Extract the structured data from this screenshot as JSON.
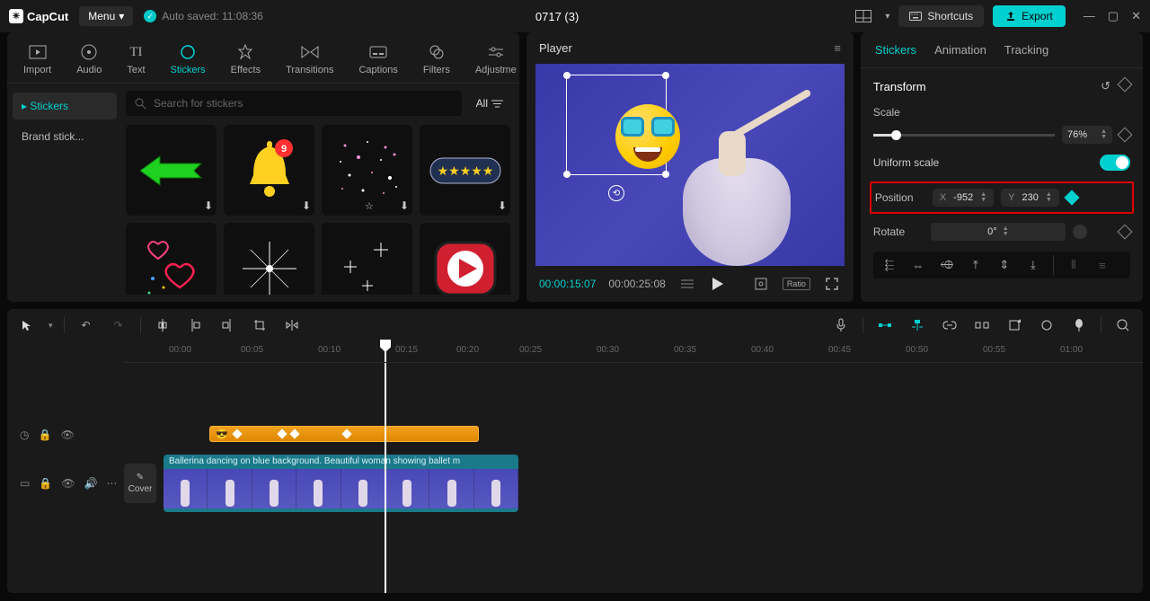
{
  "titlebar": {
    "app_name": "CapCut",
    "menu_label": "Menu",
    "autosave_label": "Auto saved: 11:08:36",
    "project_title": "0717 (3)",
    "shortcuts_label": "Shortcuts",
    "export_label": "Export"
  },
  "media_tabs": {
    "items": [
      {
        "label": "Import"
      },
      {
        "label": "Audio"
      },
      {
        "label": "Text"
      },
      {
        "label": "Stickers"
      },
      {
        "label": "Effects"
      },
      {
        "label": "Transitions"
      },
      {
        "label": "Captions"
      },
      {
        "label": "Filters"
      },
      {
        "label": "Adjustme"
      }
    ],
    "active_index": 3
  },
  "sticker_sidebar": {
    "items": [
      "Stickers",
      "Brand stick..."
    ],
    "active_index": 0
  },
  "sticker_search": {
    "placeholder": "Search for stickers",
    "all_label": "All"
  },
  "player": {
    "title": "Player",
    "time_current": "00:00:15:07",
    "time_total": "00:00:25:08",
    "ratio_label": "Ratio"
  },
  "props": {
    "tabs": [
      "Stickers",
      "Animation",
      "Tracking"
    ],
    "active_index": 0,
    "section_title": "Transform",
    "scale_label": "Scale",
    "scale_value": "76%",
    "uniform_label": "Uniform scale",
    "position_label": "Position",
    "pos_x_label": "X",
    "pos_x_value": "-952",
    "pos_y_label": "Y",
    "pos_y_value": "230",
    "rotate_label": "Rotate",
    "rotate_value": "0°"
  },
  "timeline": {
    "ruler_ticks": [
      "00:00",
      "00:05",
      "00:10",
      "00:15",
      "00:20",
      "00:25",
      "00:30",
      "00:35",
      "00:40",
      "00:45",
      "00:50",
      "00:55",
      "01:00"
    ],
    "clip_title": "Ballerina dancing on blue background. Beautiful woman showing ballet m",
    "cover_label": "Cover"
  }
}
